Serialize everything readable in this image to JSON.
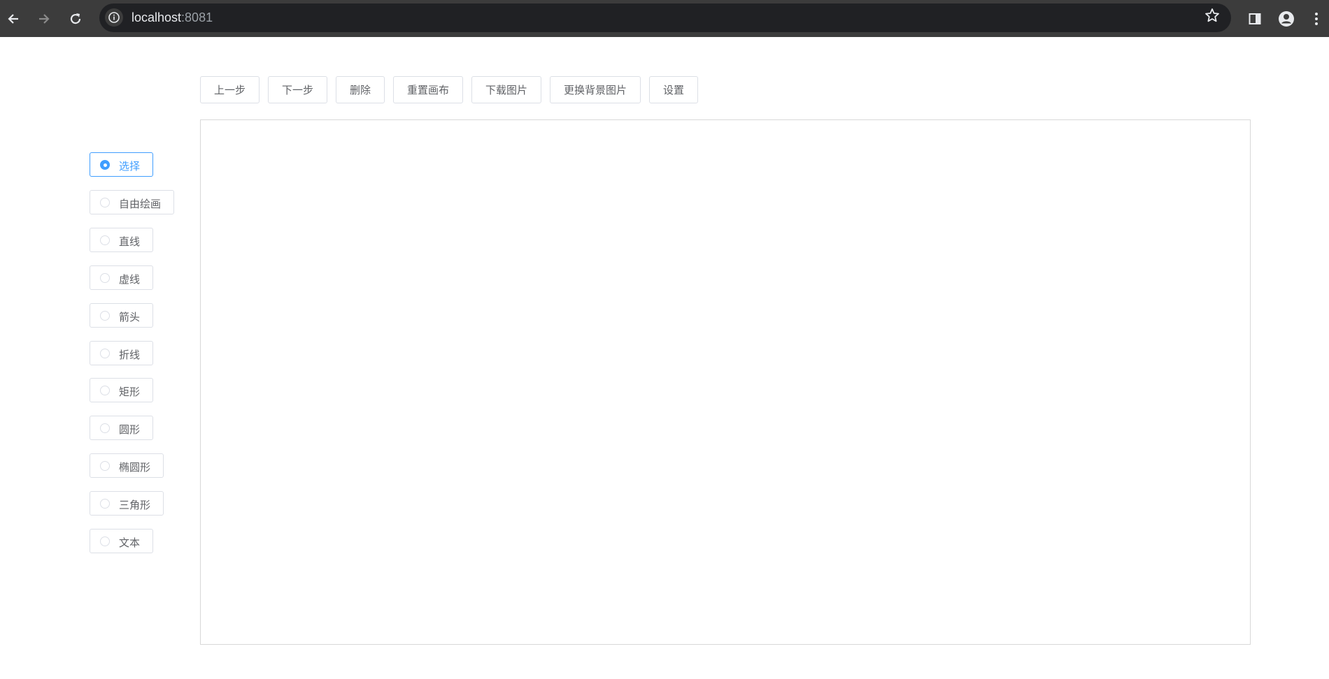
{
  "browser": {
    "url_host": "localhost",
    "url_port": ":8081",
    "icons": {
      "back": "back-arrow-icon",
      "forward": "forward-arrow-icon",
      "reload": "reload-icon",
      "info": "info-icon",
      "bookmark": "star-icon",
      "side_panel": "side-panel-icon",
      "profile": "profile-icon",
      "menu": "kebab-menu-icon"
    }
  },
  "toolbar": {
    "undo": "上一步",
    "redo": "下一步",
    "delete": "删除",
    "reset": "重置画布",
    "download": "下载图片",
    "change_bg": "更换背景图片",
    "settings": "设置"
  },
  "tools": {
    "selected": "选择",
    "items": [
      "选择",
      "自由绘画",
      "直线",
      "虚线",
      "箭头",
      "折线",
      "矩形",
      "圆形",
      "椭圆形",
      "三角形",
      "文本"
    ]
  },
  "colors": {
    "accent": "#409eff",
    "border": "#dcdfe6",
    "text": "#606266",
    "chrome": "#3c3c3c",
    "omnibox": "#202124"
  }
}
